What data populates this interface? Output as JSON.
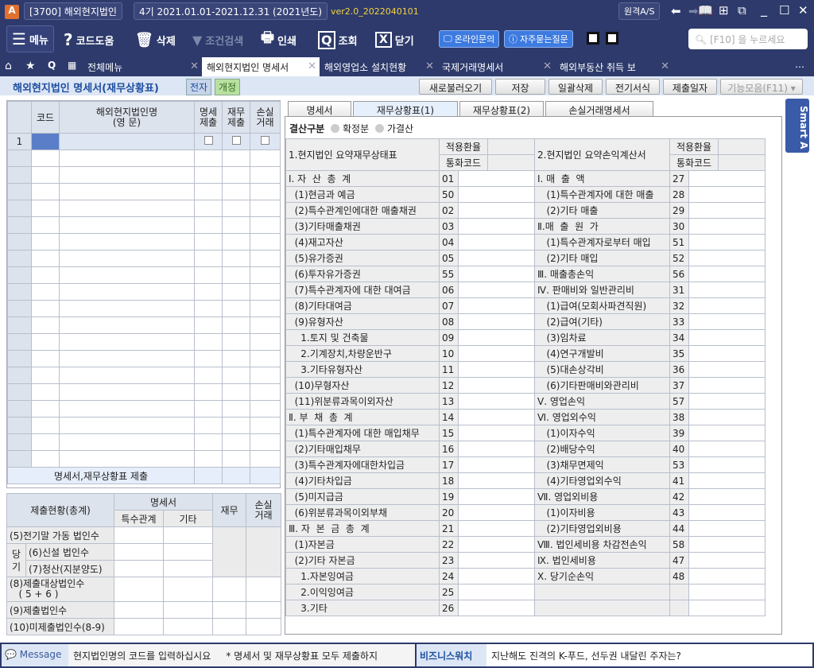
{
  "titlebar": {
    "program": "[3700] 해외현지법인",
    "period": "4기  2021.01.01-2021.12.31  (2021년도)",
    "version": "ver2.0_2022040101",
    "remote": "원격A/S"
  },
  "toolbar": {
    "menu": "메뉴",
    "codehelp": "코드도움",
    "delete": "삭제",
    "filter": "조건검색",
    "print": "인쇄",
    "search": "조회",
    "close": "닫기",
    "online": "온라인문의",
    "faq": "자주묻는질문",
    "search_placeholder": "[F10] 을 누르세요"
  },
  "tabs": [
    {
      "label": "전체메뉴"
    },
    {
      "label": "해외현지법인 명세서"
    },
    {
      "label": "해외영업소 설치현황"
    },
    {
      "label": "국제거래명세서"
    },
    {
      "label": "해외부동산 취득 보"
    }
  ],
  "subheader": {
    "title": "해외현지법인 명세서(재무상황표)",
    "badge1": "전자",
    "badge2": "개정",
    "buttons": [
      "새로불러오기",
      "저장",
      "일괄삭제",
      "전기서식",
      "제출일자",
      "기능모음(F11)"
    ]
  },
  "left_grid": {
    "headers": [
      "코드",
      "해외현지법인명\n(영 문)",
      "명세\n제출",
      "재무\n제출",
      "손실\n거래"
    ],
    "first_row": "1",
    "footer": "명세서,재무상황표 제출"
  },
  "summary": {
    "title": "제출현황(총계)",
    "col_group": "명세서",
    "cols": [
      "특수관계",
      "기타",
      "재무",
      "손실\n거래"
    ],
    "side": "당\n기",
    "rows": [
      "(5)전기말 가동 법인수",
      "(6)신설 법인수",
      "(7)청산(지분양도)",
      "(8)제출대상법인수\n   ( 5 + 6 )",
      "(9)제출법인수",
      "(10)미제출법인수(8-9)"
    ]
  },
  "right_tabs": [
    "명세서",
    "재무상황표(1)",
    "재무상황표(2)",
    "손실거래명세서"
  ],
  "settlement": {
    "label": "결산구분",
    "options": [
      "확정분",
      "가결산"
    ]
  },
  "bs": {
    "title": "1.현지법인 요약재무상태표",
    "rate": "적용환율",
    "currency": "통화코드",
    "rows": [
      [
        "Ⅰ. 자  산  총  계",
        "01"
      ],
      [
        "  (1)현금과 예금",
        "50"
      ],
      [
        "  (2)특수관계인에대한 매출채권",
        "02"
      ],
      [
        "  (3)기타매출채권",
        "03"
      ],
      [
        "  (4)재고자산",
        "04"
      ],
      [
        "  (5)유가증권",
        "05"
      ],
      [
        "  (6)투자유가증권",
        "55"
      ],
      [
        "  (7)특수관계자에 대한 대여금",
        "06"
      ],
      [
        "  (8)기타대여금",
        "07"
      ],
      [
        "  (9)유형자산",
        "08"
      ],
      [
        "    1.토지 및 건축물",
        "09"
      ],
      [
        "    2.기계장치,차량운반구",
        "10"
      ],
      [
        "    3.기타유형자산",
        "11"
      ],
      [
        "  (10)무형자산",
        "12"
      ],
      [
        "  (11)위분류과목이외자산",
        "13"
      ],
      [
        "Ⅱ. 부  채  총  계",
        "14"
      ],
      [
        "  (1)특수관계자에 대한 매입채무",
        "15"
      ],
      [
        "  (2)기타매입채무",
        "16"
      ],
      [
        "  (3)특수관계자에대한차입금",
        "17"
      ],
      [
        "  (4)기타차입금",
        "18"
      ],
      [
        "  (5)미지급금",
        "19"
      ],
      [
        "  (6)위분류과목이외부채",
        "20"
      ],
      [
        "Ⅲ. 자  본  금  총  계",
        "21"
      ],
      [
        "  (1)자본금",
        "22"
      ],
      [
        "  (2)기타 자본금",
        "23"
      ],
      [
        "    1.자본잉여금",
        "24"
      ],
      [
        "    2.이익잉여금",
        "25"
      ],
      [
        "    3.기타",
        "26"
      ]
    ]
  },
  "is": {
    "title": "2.현지법인 요약손익계산서",
    "rate": "적용환율",
    "currency": "통화코드",
    "rows": [
      [
        "Ⅰ. 매  출  액",
        "27"
      ],
      [
        "   (1)특수관계자에 대한 매출",
        "28"
      ],
      [
        "   (2)기타 매출",
        "29"
      ],
      [
        "Ⅱ.매  출  원  가",
        "30"
      ],
      [
        "   (1)특수관계자로부터 매입",
        "51"
      ],
      [
        "   (2)기타 매입",
        "52"
      ],
      [
        "Ⅲ. 매출총손익",
        "56"
      ],
      [
        "Ⅳ. 판매비와 일반관리비",
        "31"
      ],
      [
        "   (1)급여(모회사파견직원)",
        "32"
      ],
      [
        "   (2)급여(기타)",
        "33"
      ],
      [
        "   (3)임차료",
        "34"
      ],
      [
        "   (4)연구개발비",
        "35"
      ],
      [
        "   (5)대손상각비",
        "36"
      ],
      [
        "   (6)기타판매비와관리비",
        "37"
      ],
      [
        "Ⅴ. 영업손익",
        "57"
      ],
      [
        "Ⅵ. 영업외수익",
        "38"
      ],
      [
        "   (1)이자수익",
        "39"
      ],
      [
        "   (2)배당수익",
        "40"
      ],
      [
        "   (3)채무면제익",
        "53"
      ],
      [
        "   (4)기타영업외수익",
        "41"
      ],
      [
        "Ⅶ. 영업외비용",
        "42"
      ],
      [
        "   (1)이자비용",
        "43"
      ],
      [
        "   (2)기타영업외비용",
        "44"
      ],
      [
        "Ⅷ. 법인세비용 차감전손익",
        "58"
      ],
      [
        "Ⅸ. 법인세비용",
        "47"
      ],
      [
        "Ⅹ. 당기순손익",
        "48"
      ],
      [
        "",
        ""
      ],
      [
        "",
        ""
      ]
    ]
  },
  "side_tab": "Smart A",
  "status": {
    "message_label": "Message",
    "message": "현지법인명의 코드를 입력하십시요",
    "note": "* 명세서 및 재무상황표 모두 제출하지",
    "news_label": "비즈니스워치",
    "news": "지난해도 진격의 K-푸드, 선두권 내달린 주자는?"
  },
  "colors": {
    "navy": "#2d3a6b",
    "accent": "#3d7be0"
  }
}
